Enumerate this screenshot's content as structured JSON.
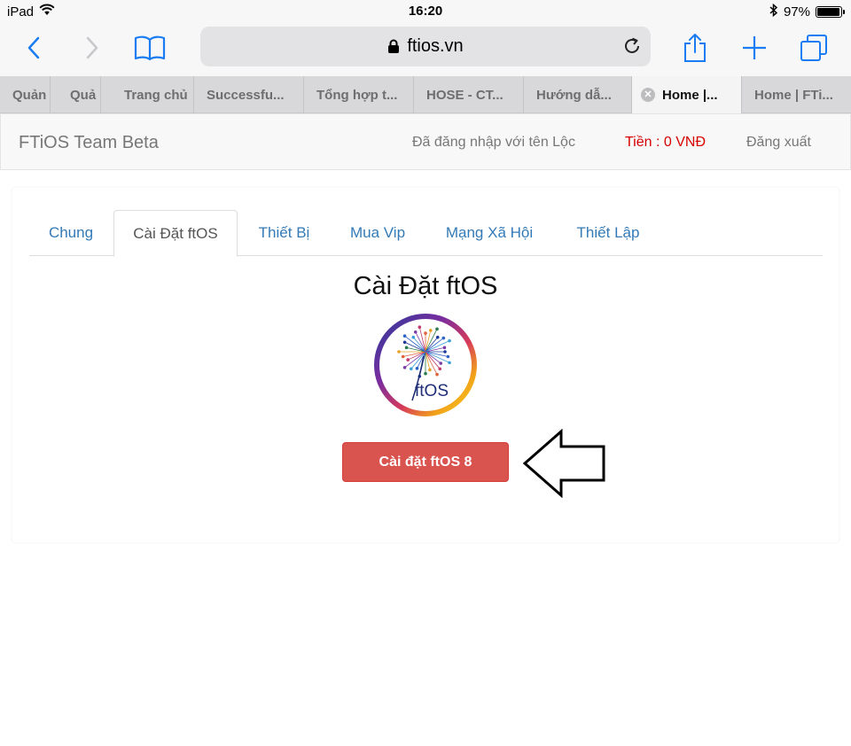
{
  "status_bar": {
    "device": "iPad",
    "time": "16:20",
    "battery": "97%",
    "battery_level": 0.97
  },
  "browser": {
    "url": "ftios.vn",
    "tabs": [
      {
        "label": "Quản"
      },
      {
        "label": "Quả"
      },
      {
        "label": "Trang chủ"
      },
      {
        "label": "Successfu..."
      },
      {
        "label": "Tổng hợp t..."
      },
      {
        "label": "HOSE - CT..."
      },
      {
        "label": "Hướng dẫ..."
      },
      {
        "label": "Home |..."
      },
      {
        "label": "Home | FTi..."
      }
    ]
  },
  "navbar": {
    "brand": "FTiOS Team Beta",
    "logged_in": "Đã đăng nhập với tên Lộc",
    "money": "Tiền : 0 VNĐ",
    "logout": "Đăng xuất"
  },
  "content": {
    "tabs": [
      {
        "label": "Chung"
      },
      {
        "label": "Cài Đặt ftOS"
      },
      {
        "label": "Thiết Bị"
      },
      {
        "label": "Mua Vip"
      },
      {
        "label": "Mạng Xã Hội"
      },
      {
        "label": "Thiết Lập"
      }
    ],
    "title": "Cài Đặt ftOS",
    "logo_text": "ftOS",
    "install_button": "Cài đặt ftOS 8"
  },
  "colors": {
    "link": "#337ab7",
    "danger": "#d9534f",
    "money": "#d60000"
  }
}
